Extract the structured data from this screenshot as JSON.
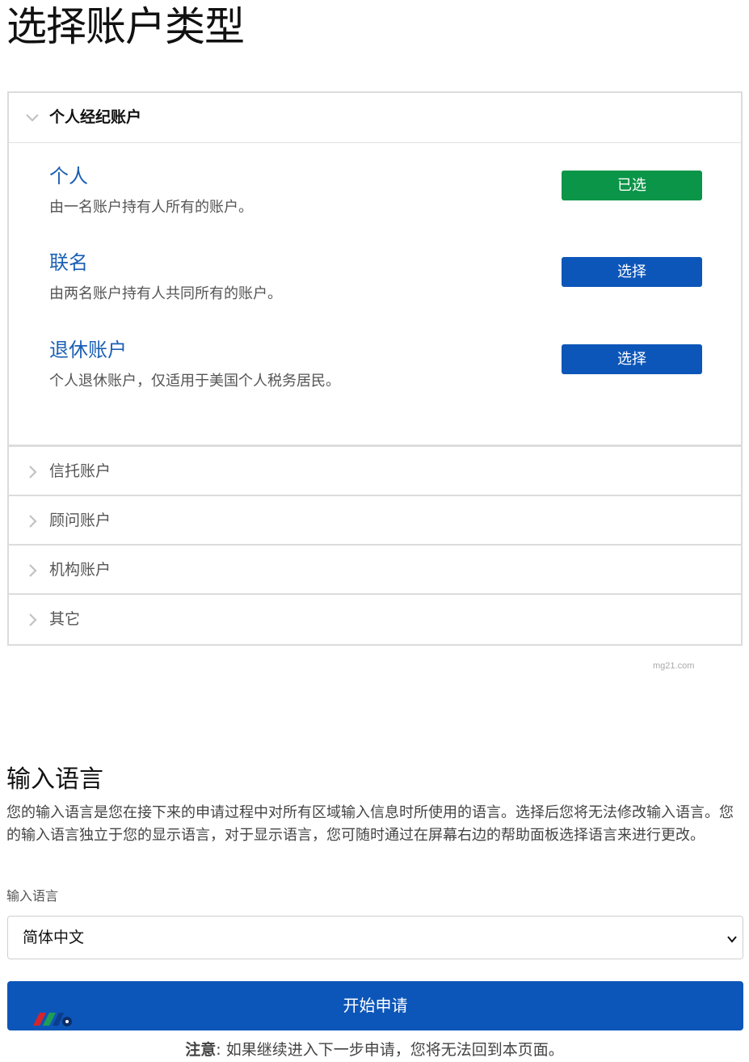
{
  "page": {
    "title": "选择账户类型"
  },
  "accordion": {
    "open_section": {
      "title": "个人经纪账户",
      "accounts": [
        {
          "name": "个人",
          "description": "由一名账户持有人所有的账户。",
          "button": "已选",
          "selected": true
        },
        {
          "name": "联名",
          "description": "由两名账户持有人共同所有的账户。",
          "button": "选择",
          "selected": false
        },
        {
          "name": "退休账户",
          "description": "个人退休账户，仅适用于美国个人税务居民。",
          "button": "选择",
          "selected": false
        }
      ]
    },
    "collapsed_sections": [
      {
        "title": "信托账户"
      },
      {
        "title": "顾问账户"
      },
      {
        "title": "机构账户"
      },
      {
        "title": "其它"
      }
    ]
  },
  "watermark": "mg21.com",
  "input_language": {
    "heading": "输入语言",
    "description": "您的输入语言是您在接下来的申请过程中对所有区域输入信息时所使用的语言。选择后您将无法修改输入语言。您的输入语言独立于您的显示语言，对于显示语言，您可随时通过在屏幕右边的帮助面板选择语言来进行更改。",
    "field_label": "输入语言",
    "selected_value": "简体中文"
  },
  "start_button": {
    "label": "开始申请"
  },
  "notice": {
    "label": "注意",
    "text": ": 如果继续进入下一步申请，您将无法回到本页面。"
  },
  "colors": {
    "primary": "#0d56b9",
    "selected": "#0a9548",
    "link": "#1a5fb4"
  }
}
